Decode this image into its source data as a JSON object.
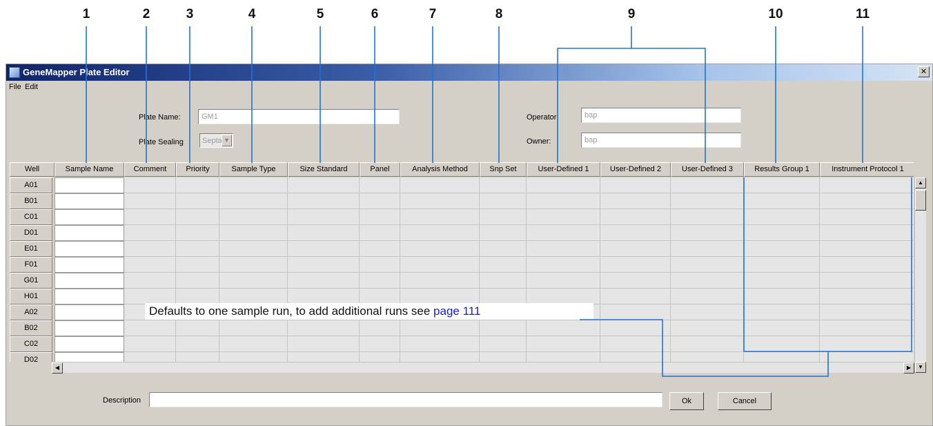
{
  "callouts": [
    "1",
    "2",
    "3",
    "4",
    "5",
    "6",
    "7",
    "8",
    "9",
    "10",
    "11"
  ],
  "window": {
    "title": "GeneMapper Plate Editor",
    "close_glyph": "✕",
    "icon": "genemapper-app-icon"
  },
  "menu": [
    "File",
    "Edit"
  ],
  "form": {
    "plate_name_label": "Plate Name:",
    "plate_name_value": "GM1",
    "plate_sealing_label": "Plate Sealing",
    "plate_sealing_value": "Septa",
    "operator_label": "Operator:",
    "operator_value": "bap",
    "owner_label": "Owner:",
    "owner_value": "bap"
  },
  "table": {
    "columns": [
      "Well",
      "Sample Name",
      "Comment",
      "Priority",
      "Sample Type",
      "Size Standard",
      "Panel",
      "Analysis Method",
      "Snp Set",
      "User-Defined 1",
      "User-Defined 2",
      "User-Defined 3",
      "Results Group 1",
      "Instrument Protocol 1"
    ],
    "wells": [
      "A01",
      "B01",
      "C01",
      "D01",
      "E01",
      "F01",
      "G01",
      "H01",
      "A02",
      "B02",
      "C02",
      "D02"
    ]
  },
  "note": {
    "text": "Defaults to one sample run, to add additional runs see ",
    "link": "page 111"
  },
  "footer": {
    "description_label": "Description",
    "ok_label": "Ok",
    "cancel_label": "Cancel"
  },
  "colors": {
    "callout_line": "#1f73d1",
    "link": "#1a1fd6"
  }
}
